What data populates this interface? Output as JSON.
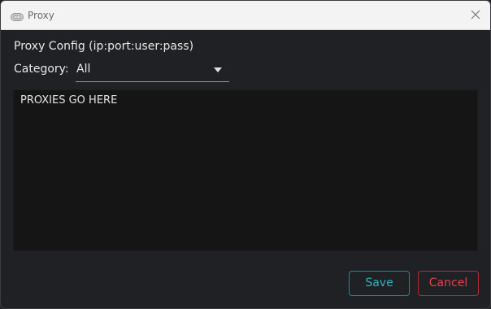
{
  "window": {
    "title": "Proxy",
    "icon": "proxy-icon",
    "close_icon": "close-icon"
  },
  "config": {
    "label": "Proxy Config (ip:port:user:pass)"
  },
  "category": {
    "label": "Category:",
    "selected": "All"
  },
  "proxies": {
    "value": "PROXIES GO HERE"
  },
  "actions": {
    "save_label": "Save",
    "cancel_label": "Cancel"
  },
  "colors": {
    "save_accent": "#2bb6c1",
    "cancel_accent": "#e0434d",
    "background": "#202124",
    "textarea_bg": "#151515"
  }
}
